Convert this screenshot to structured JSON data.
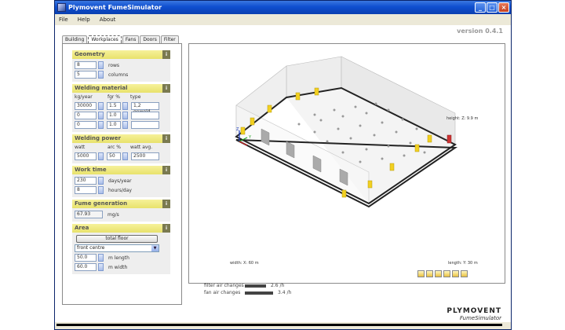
{
  "window": {
    "title": "Plymovent FumeSimulator"
  },
  "menu": [
    "File",
    "Help",
    "About"
  ],
  "version": "version 0.4.1",
  "tabs": [
    "Building",
    "Workplaces",
    "Fans",
    "Doors",
    "Filter"
  ],
  "active_tab": "Workplaces",
  "geometry": {
    "title": "Geometry",
    "rows": "8",
    "rows_label": "rows",
    "columns": "5",
    "columns_label": "columns"
  },
  "welding_material": {
    "title": "Welding material",
    "headers": [
      "kg/year",
      "fgr %",
      "type"
    ],
    "rows": [
      {
        "kg": "30000",
        "fgr": "1.5",
        "type": "1,2 gewold"
      },
      {
        "kg": "0",
        "fgr": "1.0",
        "type": ""
      },
      {
        "kg": "0",
        "fgr": "1.0",
        "type": ""
      }
    ]
  },
  "welding_power": {
    "title": "Welding power",
    "headers": [
      "watt",
      "arc %",
      "watt avg."
    ],
    "watt": "5000",
    "arc": "50",
    "watt_avg": "2500"
  },
  "work_time": {
    "title": "Work time",
    "days": "230",
    "days_label": "days/year",
    "hours": "8",
    "hours_label": "hours/day"
  },
  "fume_generation": {
    "title": "Fume generation",
    "value": "67.93",
    "unit": "mg/s"
  },
  "area": {
    "title": "Area",
    "button": "total floor",
    "select": "front centre",
    "length": "50.0",
    "length_label": "m length",
    "width": "60.0",
    "width_label": "m width"
  },
  "view": {
    "height_label": "height: Z: 9.9 m",
    "width_label": "width: X: 60 m",
    "length_label": "length: Y: 30 m"
  },
  "stats": {
    "filter_label": "filter air changes",
    "filter_value": "2.6 /h",
    "filter_frac": 0.75,
    "fan_label": "fan air changes",
    "fan_value": "3.4 /h",
    "fan_frac": 1.0
  },
  "logo": {
    "brand": "PLYMOVENT",
    "sub": "FumeSimulator"
  },
  "colors": {
    "title_bar": "#0f4fd0",
    "section_header": "#e8e26c",
    "fan_yellow": "#f2d020",
    "floor_edge": "#222222"
  }
}
